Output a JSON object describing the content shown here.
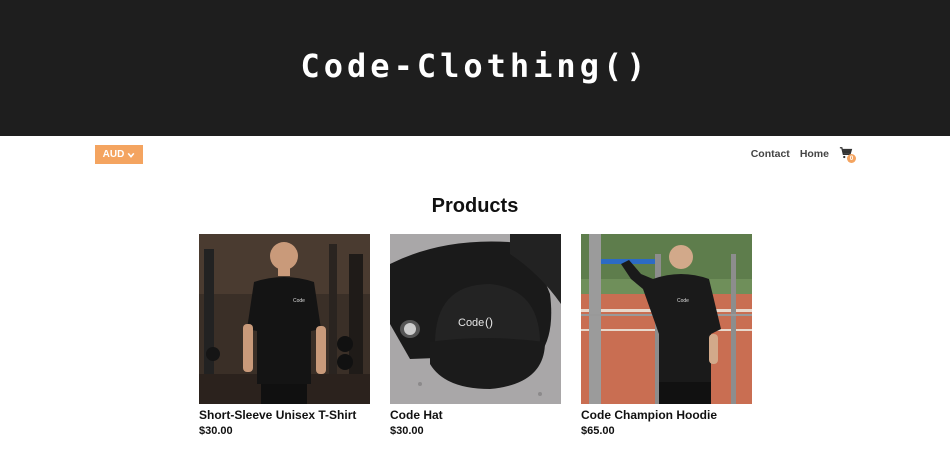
{
  "header": {
    "title": "Code-Clothing()"
  },
  "currency": {
    "label": "AUD"
  },
  "nav": {
    "contact": "Contact",
    "home": "Home",
    "cart_count": "0"
  },
  "section": {
    "title": "Products"
  },
  "products": [
    {
      "name": "Short-Sleeve Unisex T-Shirt",
      "price": "$30.00",
      "logo_text": "Code"
    },
    {
      "name": "Code Hat",
      "price": "$30.00",
      "logo_text": "Code"
    },
    {
      "name": "Code Champion Hoodie",
      "price": "$65.00",
      "logo_text": "Code"
    }
  ],
  "colors": {
    "banner": "#1e1e1e",
    "accent": "#f4a460"
  },
  "icons": {
    "currency_toggle": "chevron-down-icon",
    "cart": "cart-icon"
  }
}
